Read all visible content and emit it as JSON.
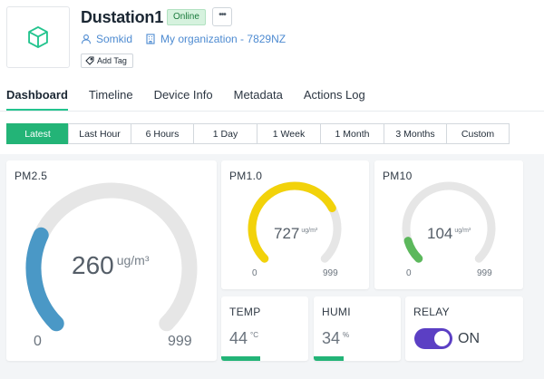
{
  "device": {
    "name": "Dustation1",
    "status": "Online",
    "more_label": "•••",
    "owner": "Somkid",
    "organization": "My organization - 7829NZ",
    "add_tag_label": "Add Tag",
    "icons": {
      "avatar": "cube-icon",
      "owner": "user-icon",
      "organization": "building-icon",
      "tag": "tag-icon"
    }
  },
  "tabs": [
    {
      "label": "Dashboard",
      "active": true
    },
    {
      "label": "Timeline",
      "active": false
    },
    {
      "label": "Device Info",
      "active": false
    },
    {
      "label": "Metadata",
      "active": false
    },
    {
      "label": "Actions Log",
      "active": false
    }
  ],
  "time_ranges": [
    {
      "label": "Latest",
      "active": true
    },
    {
      "label": "Last Hour",
      "active": false
    },
    {
      "label": "6 Hours",
      "active": false
    },
    {
      "label": "1 Day",
      "active": false
    },
    {
      "label": "1 Week",
      "active": false
    },
    {
      "label": "1 Month",
      "active": false
    },
    {
      "label": "3 Months",
      "active": false
    },
    {
      "label": "Custom",
      "active": false
    }
  ],
  "widgets": {
    "pm25": {
      "title": "PM2.5",
      "value": 260,
      "unit": "ug/m³",
      "min": 0,
      "max": 999,
      "min_label": "0",
      "max_label": "999",
      "value_label": "260",
      "color": "#4a98c6"
    },
    "pm10_small": {
      "title": "PM1.0",
      "value": 727,
      "unit": "ug/m³",
      "min": 0,
      "max": 999,
      "min_label": "0",
      "max_label": "999",
      "value_label": "727",
      "color": "#f2d20a"
    },
    "pm10": {
      "title": "PM10",
      "value": 104,
      "unit": "ug/m³",
      "min": 0,
      "max": 999,
      "min_label": "0",
      "max_label": "999",
      "value_label": "104",
      "color": "#5cb85c"
    },
    "temp": {
      "title": "TEMP",
      "value_label": "44",
      "unit": "°C",
      "level": 0.45
    },
    "humi": {
      "title": "HUMI",
      "value_label": "34",
      "unit": "%",
      "level": 0.34
    },
    "relay": {
      "title": "RELAY",
      "state_label": "ON",
      "on": true,
      "color": "#5b3fc4"
    }
  },
  "colors": {
    "accent": "#23b477",
    "link": "#4e8bd1",
    "track": "#e6e6e6"
  }
}
